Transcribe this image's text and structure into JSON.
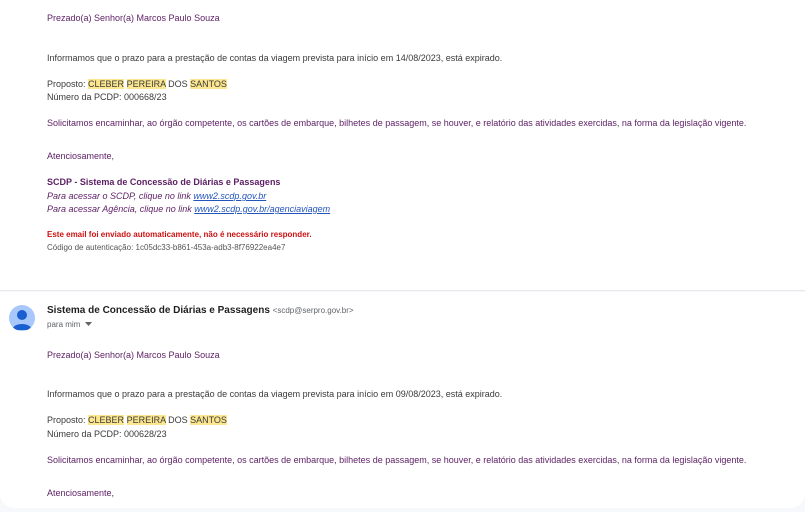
{
  "email1": {
    "greeting": "Prezado(a) Senhor(a) Marcos Paulo Souza",
    "body": "Informamos que o prazo para a prestação de contas da viagem prevista para início em 14/08/2023, está expirado.",
    "proposto_label": "Proposto: ",
    "name_part1": "CLEBER",
    "name_part2": "PEREIRA",
    "name_part3": " DOS ",
    "name_part4": "SANTOS",
    "pcdp": "Número da PCDP: 000668/23",
    "request": "Solicitamos encaminhar, ao órgão competente, os cartões de embarque, bilhetes de passagem, se houver, e relatório das atividades exercidas, na forma da legislação vigente.",
    "closing": "Atenciosamente,",
    "signature": "SCDP - Sistema de Concessão de Diárias e Passagens",
    "scdp_line": "Para acessar o SCDP, clique no link ",
    "scdp_link": "www2.scdp.gov.br",
    "agencia_line": "Para acessar Agência, clique no link ",
    "agencia_link": "www2.scdp.gov.br/agenciaviagem",
    "auto_notice": "Este email foi enviado automaticamente, não é necessário responder.",
    "auth_code": "Código de autenticação: 1c05dc33-b861-453a-adb3-8f76922ea4e7"
  },
  "email2": {
    "sender_name": "Sistema de Concessão de Diárias e Passagens",
    "sender_email": "<scdp@serpro.gov.br>",
    "to_me": "para mim",
    "greeting": "Prezado(a) Senhor(a) Marcos Paulo Souza",
    "body": "Informamos que o prazo para a prestação de contas da viagem prevista para início em 09/08/2023, está expirado.",
    "proposto_label": "Proposto: ",
    "name_part1": "CLEBER",
    "name_part2": "PEREIRA",
    "name_part3": " DOS ",
    "name_part4": "SANTOS",
    "pcdp": "Número da PCDP: 000628/23",
    "request": "Solicitamos encaminhar, ao órgão competente, os cartões de embarque, bilhetes de passagem, se houver, e relatório das atividades exercidas, na forma da legislação vigente.",
    "closing": "Atenciosamente,"
  },
  "colors": {
    "body_text": "#5c1e64",
    "highlight": "#fce78f",
    "link": "#2255bb",
    "notice": "#cc1111",
    "avatar": "#a8c7fa"
  },
  "icons": {
    "avatar": "person-avatar-icon",
    "dropdown": "caret-down-icon"
  }
}
